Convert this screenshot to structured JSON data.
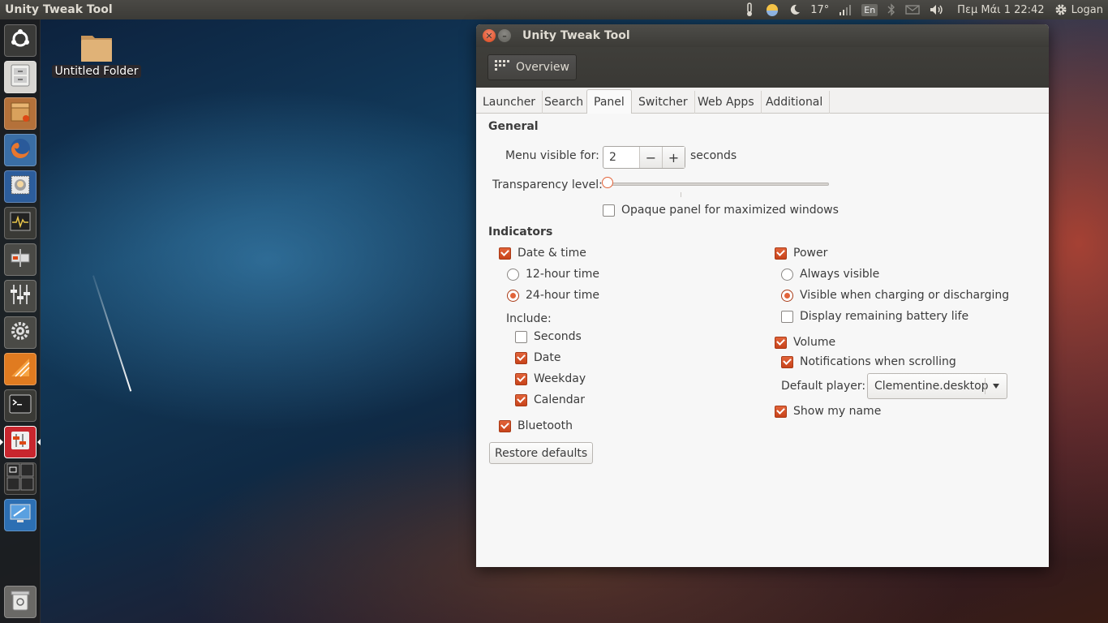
{
  "top_panel": {
    "app_title": "Unity Tweak Tool",
    "temperature": "17°",
    "language": "En",
    "clock": "Πεμ Μάι  1 22:42",
    "user": "Logan"
  },
  "desktop": {
    "folder_label": "Untitled Folder"
  },
  "launcher": {
    "items": [
      "dash-home",
      "files",
      "software-installer",
      "firefox",
      "thunderbird",
      "system-monitor",
      "disks",
      "mixer-settings",
      "system-settings",
      "vlc",
      "terminal",
      "unity-tweak-tool",
      "workspace-switcher",
      "remote-desktop",
      "trash"
    ]
  },
  "window": {
    "title": "Unity Tweak Tool",
    "overview_label": "Overview",
    "tabs": [
      "Launcher",
      "Search",
      "Panel",
      "Switcher",
      "Web Apps",
      "Additional"
    ],
    "active_tab": "Panel",
    "general": {
      "title": "General",
      "menu_visible_label": "Menu visible for:",
      "menu_visible_value": "2",
      "minus": "−",
      "plus": "+",
      "seconds_label": "seconds",
      "transparency_label": "Transparency level:",
      "transparency_value": 0,
      "opaque_label": "Opaque panel for maximized windows",
      "opaque_checked": false
    },
    "indicators": {
      "title": "Indicators",
      "date_time": {
        "label": "Date & time",
        "checked": true
      },
      "hour12": {
        "label": "12-hour time",
        "checked": false
      },
      "hour24": {
        "label": "24-hour time",
        "checked": true
      },
      "include_label": "Include:",
      "seconds": {
        "label": "Seconds",
        "checked": false
      },
      "date": {
        "label": "Date",
        "checked": true
      },
      "weekday": {
        "label": "Weekday",
        "checked": true
      },
      "calendar": {
        "label": "Calendar",
        "checked": true
      },
      "bluetooth": {
        "label": "Bluetooth",
        "checked": true
      },
      "power": {
        "label": "Power",
        "checked": true
      },
      "always_visible": {
        "label": "Always visible",
        "checked": false
      },
      "visible_charging": {
        "label": "Visible when charging or discharging",
        "checked": true
      },
      "battery_life": {
        "label": "Display remaining battery life",
        "checked": false
      },
      "volume": {
        "label": "Volume",
        "checked": true
      },
      "notifications_scrolling": {
        "label": "Notifications when scrolling",
        "checked": true
      },
      "default_player_label": "Default player:",
      "default_player_value": "Clementine.desktop",
      "show_name": {
        "label": "Show my name",
        "checked": true
      }
    },
    "restore_label": "Restore defaults"
  },
  "colors": {
    "accent": "#dd4814",
    "panel_bg": "#3c3b37"
  }
}
